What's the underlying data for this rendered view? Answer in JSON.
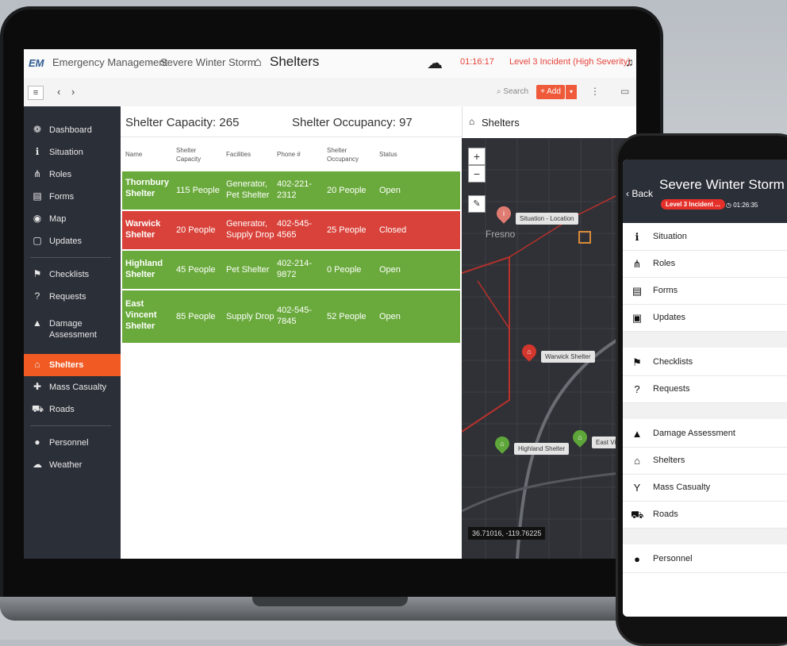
{
  "app": {
    "logo": "EM",
    "breadcrumb": [
      "Emergency Management",
      "Severe Winter Storm"
    ],
    "page_title": "Shelters",
    "timer": "01:16:17",
    "incident_level": "Level 3 Incident (High Severity)"
  },
  "toolbar": {
    "search_placeholder": "Search",
    "add_label": "+ Add"
  },
  "sidebar": {
    "items": [
      {
        "label": "Dashboard",
        "icon": "dashboard-icon",
        "glyph": "❁"
      },
      {
        "label": "Situation",
        "icon": "info-icon",
        "glyph": "ℹ"
      },
      {
        "label": "Roles",
        "icon": "org-chart-icon",
        "glyph": "⋔"
      },
      {
        "label": "Forms",
        "icon": "form-icon",
        "glyph": "▤"
      },
      {
        "label": "Map",
        "icon": "map-pin-icon",
        "glyph": "◉"
      },
      {
        "label": "Updates",
        "icon": "chat-icon",
        "glyph": "▢"
      },
      {
        "label": "Checklists",
        "icon": "flag-icon",
        "glyph": "⚑"
      },
      {
        "label": "Requests",
        "icon": "question-icon",
        "glyph": "?"
      },
      {
        "label": "Damage",
        "label2": "Assessment",
        "icon": "warning-icon",
        "glyph": "▲"
      },
      {
        "label": "Shelters",
        "icon": "home-icon",
        "glyph": "⌂"
      },
      {
        "label": "Mass Casualty",
        "icon": "medical-cross-icon",
        "glyph": "✚"
      },
      {
        "label": "Roads",
        "icon": "road-icon",
        "glyph": "⛟"
      },
      {
        "label": "Personnel",
        "icon": "person-icon",
        "glyph": "●"
      },
      {
        "label": "Weather",
        "icon": "weather-icon",
        "glyph": "☁"
      }
    ],
    "active": "Shelters"
  },
  "summary": {
    "capacity": "Shelter Capacity: 265",
    "occupancy": "Shelter Occupancy: 97"
  },
  "table": {
    "headers": [
      {
        "line1": "Name"
      },
      {
        "line1": "Shelter",
        "line2": "Capacity"
      },
      {
        "line1": "Facilities"
      },
      {
        "line1": "Phone #"
      },
      {
        "line1": "Shelter",
        "line2": "Occupancy"
      },
      {
        "line1": "Status"
      }
    ],
    "rows": [
      {
        "name": [
          "Thornbury",
          "Shelter"
        ],
        "capacity": "115 People",
        "facilities": [
          "Generator,",
          "Pet Shelter"
        ],
        "phone": [
          "402-221-",
          "2312"
        ],
        "occupancy": "20 People",
        "status": "Open"
      },
      {
        "name": [
          "Warwick",
          "Shelter"
        ],
        "capacity": "20 People",
        "facilities": [
          "Generator,",
          "Supply Drop"
        ],
        "phone": [
          "402-545-",
          "4565"
        ],
        "occupancy": "25 People",
        "status": "Closed"
      },
      {
        "name": [
          "Highland",
          "Shelter"
        ],
        "capacity": "45 People",
        "facilities": [
          "Pet Shelter"
        ],
        "phone": [
          "402-214-",
          "9872"
        ],
        "occupancy": "0 People",
        "status": "Open"
      },
      {
        "name": [
          "East",
          "Vincent",
          "Shelter"
        ],
        "capacity": "85 People",
        "facilities": [
          "Supply Drop"
        ],
        "phone": [
          "402-545-",
          "7845"
        ],
        "occupancy": "52 People",
        "status": "Open"
      }
    ]
  },
  "map": {
    "title": "Shelters",
    "city": "Fresno",
    "labels": {
      "situation": "Situation - Location",
      "warwick": "Warwick Shelter",
      "highland": "Highland Shelter",
      "east": "East Vi"
    },
    "coordinates": "36.71016, -119.76225",
    "zoom_in": "+",
    "zoom_out": "−"
  },
  "phone": {
    "back": "Back",
    "title": "Severe Winter Storm",
    "badge": "Level 3 Incident ...",
    "timer": "01:26:35",
    "items": [
      {
        "label": "Situation",
        "icon": "info-icon",
        "glyph": "ℹ"
      },
      {
        "label": "Roles",
        "icon": "org-chart-icon",
        "glyph": "⋔"
      },
      {
        "label": "Forms",
        "icon": "form-icon",
        "glyph": "▤"
      },
      {
        "label": "Updates",
        "icon": "chat-icon",
        "glyph": "▣"
      },
      {
        "label": "Checklists",
        "icon": "flag-icon",
        "glyph": "⚑"
      },
      {
        "label": "Requests",
        "icon": "question-icon",
        "glyph": "?"
      },
      {
        "label": "Damage Assessment",
        "icon": "warning-icon",
        "glyph": "▲"
      },
      {
        "label": "Shelters",
        "icon": "home-icon",
        "glyph": "⌂"
      },
      {
        "label": "Mass Casualty",
        "icon": "person-arms-icon",
        "glyph": "Y"
      },
      {
        "label": "Roads",
        "icon": "road-icon",
        "glyph": "⛟"
      },
      {
        "label": "Personnel",
        "icon": "person-icon",
        "glyph": "●"
      }
    ]
  },
  "colors": {
    "accent": "#f15a22",
    "open": "#6aaa3c",
    "closed": "#d9423a",
    "sidebar": "#2b2f38"
  }
}
